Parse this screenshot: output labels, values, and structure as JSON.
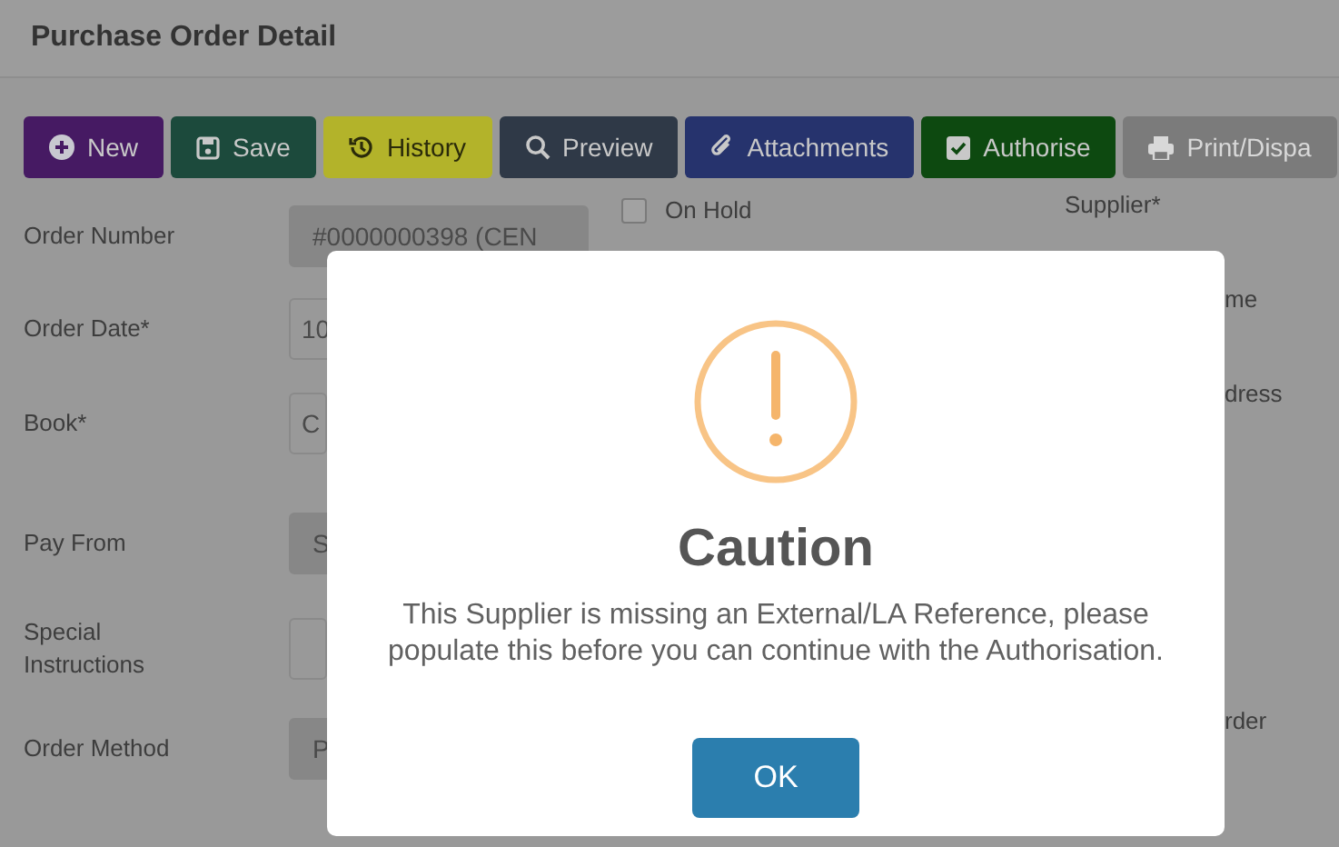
{
  "page_title": "Purchase Order Detail",
  "toolbar": [
    {
      "label": "New",
      "kind": "new"
    },
    {
      "label": "Save",
      "kind": "save"
    },
    {
      "label": "History",
      "kind": "history"
    },
    {
      "label": "Preview",
      "kind": "preview"
    },
    {
      "label": "Attachments",
      "kind": "attachments"
    },
    {
      "label": "Authorise",
      "kind": "authorise"
    },
    {
      "label": "Print/Dispa",
      "kind": "print"
    }
  ],
  "form_rows": [
    {
      "label": "Order Number",
      "value": "#0000000398 (CEN",
      "readonly": true
    },
    {
      "label": "Order Date*",
      "value": "10",
      "readonly": false
    },
    {
      "label": "Book*",
      "value": "C",
      "readonly": false
    },
    {
      "label": "Pay From",
      "value": "S",
      "readonly": true
    },
    {
      "label": "Special Instructions",
      "readonly": false
    },
    {
      "label": "Order Method",
      "value": "P",
      "readonly": true
    }
  ],
  "on_hold": {
    "label": "On Hold",
    "checked": false
  },
  "right_labels": [
    {
      "text": "Supplier*",
      "clipped": false
    },
    {
      "text": "me",
      "clipped": true
    },
    {
      "text": "dress",
      "clipped": true
    },
    {
      "text": "rder",
      "clipped": true
    }
  ],
  "dialog": {
    "title": "Caution",
    "message": "This Supplier is missing an External/LA Reference, please populate this before you can continue with the Authorisation.",
    "button": "OK"
  }
}
